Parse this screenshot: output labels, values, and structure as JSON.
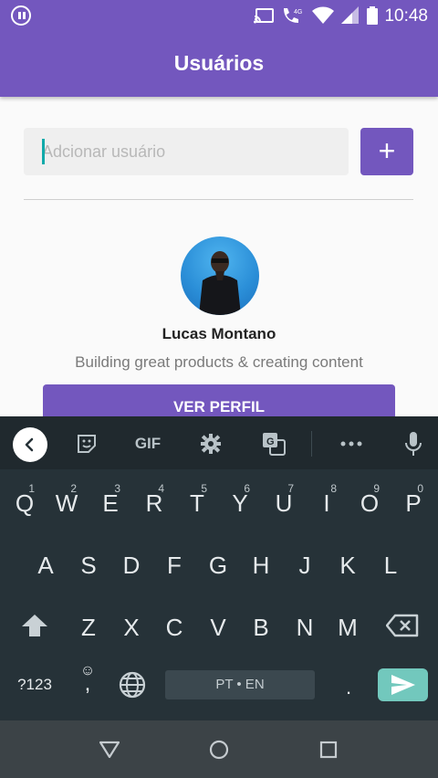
{
  "status_bar": {
    "time": "10:48",
    "network": "4G",
    "icons": [
      "pause-icon",
      "cast-icon",
      "wifi-calling-icon",
      "wifi-icon",
      "signal-icon",
      "battery-icon"
    ]
  },
  "app_bar": {
    "title": "Usuários"
  },
  "add_user": {
    "placeholder": "Adcionar usuário",
    "value": "",
    "button_label": "+"
  },
  "profile": {
    "name": "Lucas Montano",
    "bio": "Building great products & creating content",
    "button_label": "VER PERFIL"
  },
  "keyboard": {
    "toolbar": [
      "collapse-icon",
      "sticker-icon",
      "gif-icon",
      "settings-icon",
      "translate-icon",
      "more-icon",
      "mic-icon"
    ],
    "gif_label": "GIF",
    "row1": [
      "Q",
      "W",
      "E",
      "R",
      "T",
      "Y",
      "U",
      "I",
      "O",
      "P"
    ],
    "row1_hints": [
      "1",
      "2",
      "3",
      "4",
      "5",
      "6",
      "7",
      "8",
      "9",
      "0"
    ],
    "row2": [
      "A",
      "S",
      "D",
      "F",
      "G",
      "H",
      "J",
      "K",
      "L"
    ],
    "row3": [
      "Z",
      "X",
      "C",
      "V",
      "B",
      "N",
      "M"
    ],
    "symbols_key": "?123",
    "comma_key": ",",
    "emoji_key": "☺",
    "space_label": "PT • EN",
    "period_key": "."
  },
  "colors": {
    "primary": "#7357be",
    "keyboard_bg": "#263238",
    "enter_key": "#72c8bd"
  }
}
